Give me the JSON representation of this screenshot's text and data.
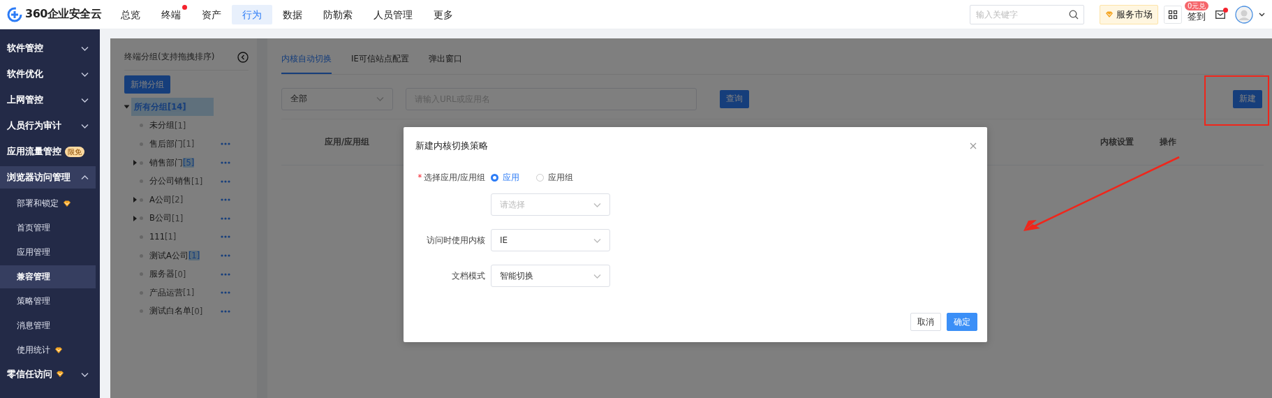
{
  "header": {
    "logo": "360企业安全云",
    "nav": [
      {
        "label": "总览",
        "selected": false,
        "dot": false
      },
      {
        "label": "终端",
        "selected": false,
        "dot": true
      },
      {
        "label": "资产",
        "selected": false,
        "dot": false
      },
      {
        "label": "行为",
        "selected": true,
        "dot": false
      },
      {
        "label": "数据",
        "selected": false,
        "dot": false
      },
      {
        "label": "防勒索",
        "selected": false,
        "dot": false
      },
      {
        "label": "人员管理",
        "selected": false,
        "dot": false
      },
      {
        "label": "更多",
        "selected": false,
        "dot": false
      }
    ],
    "search": {
      "placeholder": "输入关键字"
    },
    "market_button": "服务市场",
    "signin": {
      "label": "签到",
      "badge": "0元兑"
    },
    "mail": {
      "dot": true
    }
  },
  "sidebar": {
    "items": [
      {
        "label": "软件管控",
        "kind": "group",
        "expanded": false,
        "selected": false
      },
      {
        "label": "软件优化",
        "kind": "group",
        "expanded": false,
        "selected": false
      },
      {
        "label": "上网管控",
        "kind": "group",
        "expanded": false,
        "selected": false
      },
      {
        "label": "人员行为审计",
        "kind": "group",
        "expanded": false,
        "selected": false
      },
      {
        "label": "应用流量管控",
        "kind": "group",
        "badge": "限免",
        "selected": false
      },
      {
        "label": "浏览器访问管理",
        "kind": "group",
        "expanded": true,
        "selected": true,
        "children": [
          {
            "label": "部署和锁定",
            "kind": "sub",
            "premium": true,
            "selected": false
          },
          {
            "label": "首页管理",
            "kind": "sub",
            "premium": false,
            "selected": false
          },
          {
            "label": "应用管理",
            "kind": "sub",
            "premium": false,
            "selected": false
          },
          {
            "label": "兼容管理",
            "kind": "sub",
            "premium": false,
            "selected": true
          },
          {
            "label": "策略管理",
            "kind": "sub",
            "premium": false,
            "selected": false
          },
          {
            "label": "消息管理",
            "kind": "sub",
            "premium": false,
            "selected": false
          },
          {
            "label": "使用统计",
            "kind": "sub",
            "premium": true,
            "selected": false
          }
        ]
      },
      {
        "label": "零信任访问",
        "kind": "group",
        "premium": true,
        "expanded": false,
        "selected": false
      }
    ]
  },
  "group_panel": {
    "title": "终端分组(支持拖拽排序)",
    "add_button": "新增分组",
    "tree": [
      {
        "label": "所有分组",
        "count": "[14]",
        "count_highlighted": true,
        "selected": true,
        "expanded": true,
        "menu": false,
        "children": [
          {
            "label": "未分组",
            "count": "[1]",
            "count_highlighted": false,
            "selected": false,
            "menu": false
          },
          {
            "label": "售后部门",
            "count": "[1]",
            "count_highlighted": false,
            "selected": false,
            "menu": true
          },
          {
            "label": "销售部门",
            "count": "[5]",
            "count_highlighted": true,
            "selected": false,
            "expanded": false,
            "menu": true
          },
          {
            "label": "分公司销售",
            "count": "[1]",
            "count_highlighted": false,
            "selected": false,
            "menu": true
          },
          {
            "label": "A公司",
            "count": "[2]",
            "count_highlighted": false,
            "selected": false,
            "expanded": false,
            "menu": true
          },
          {
            "label": "B公司",
            "count": "[1]",
            "count_highlighted": false,
            "selected": false,
            "expanded": false,
            "menu": true
          },
          {
            "label": "111",
            "count": "[1]",
            "count_highlighted": false,
            "selected": false,
            "menu": true
          },
          {
            "label": "测试A公司",
            "count": "[1]",
            "count_highlighted": true,
            "selected": false,
            "menu": true
          },
          {
            "label": "服务器",
            "count": "[0]",
            "count_highlighted": false,
            "selected": false,
            "menu": true
          },
          {
            "label": "产品运营",
            "count": "[1]",
            "count_highlighted": false,
            "selected": false,
            "menu": true
          },
          {
            "label": "测试白名单",
            "count": "[0]",
            "count_highlighted": false,
            "selected": false,
            "menu": true
          }
        ]
      }
    ]
  },
  "content": {
    "tabs": [
      {
        "label": "内核自动切换",
        "selected": true
      },
      {
        "label": "IE可信站点配置",
        "selected": false
      },
      {
        "label": "弹出窗口",
        "selected": false
      }
    ],
    "filter": {
      "type_select": "全部",
      "search": {
        "placeholder": "请输入URL或应用名"
      },
      "query_button": "查询"
    },
    "new_button": "新建",
    "table": {
      "columns": [
        "应用/应用组",
        "内核设置",
        "操作"
      ]
    }
  },
  "dialog": {
    "title": "新建内核切换策略",
    "fields": [
      {
        "label": "选择应用/应用组",
        "required_mark": "*",
        "kind": "radio",
        "options": [
          {
            "label": "应用",
            "selected": true
          },
          {
            "label": "应用组",
            "selected": false
          }
        ],
        "select": {
          "placeholder": "请选择"
        }
      },
      {
        "label": "访问时使用内核",
        "kind": "select",
        "value": "IE"
      },
      {
        "label": "文档模式",
        "kind": "select",
        "value": "智能切换"
      }
    ],
    "buttons": [
      {
        "label": "取消",
        "kind": "default"
      },
      {
        "label": "确定",
        "kind": "primary"
      }
    ]
  }
}
